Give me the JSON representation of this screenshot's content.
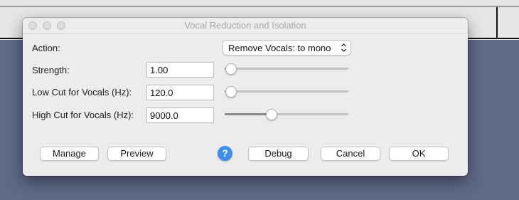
{
  "dialog": {
    "title": "Vocal Reduction and Isolation"
  },
  "action": {
    "label": "Action:",
    "selected": "Remove Vocals: to mono"
  },
  "fields": {
    "strength": {
      "label": "Strength:",
      "value": "1.00",
      "slider_fraction": 0.05
    },
    "low_cut": {
      "label": "Low Cut for Vocals (Hz):",
      "value": "120.0",
      "slider_fraction": 0.05
    },
    "high_cut": {
      "label": "High Cut for Vocals (Hz):",
      "value": "9000.0",
      "slider_fraction": 0.38
    }
  },
  "buttons": {
    "manage": "Manage",
    "preview": "Preview",
    "help": "?",
    "debug": "Debug",
    "cancel": "Cancel",
    "ok": "OK"
  },
  "icons": {
    "help_color": "#3f8cf3",
    "select_arrows": "chevron-up-down-icon"
  }
}
